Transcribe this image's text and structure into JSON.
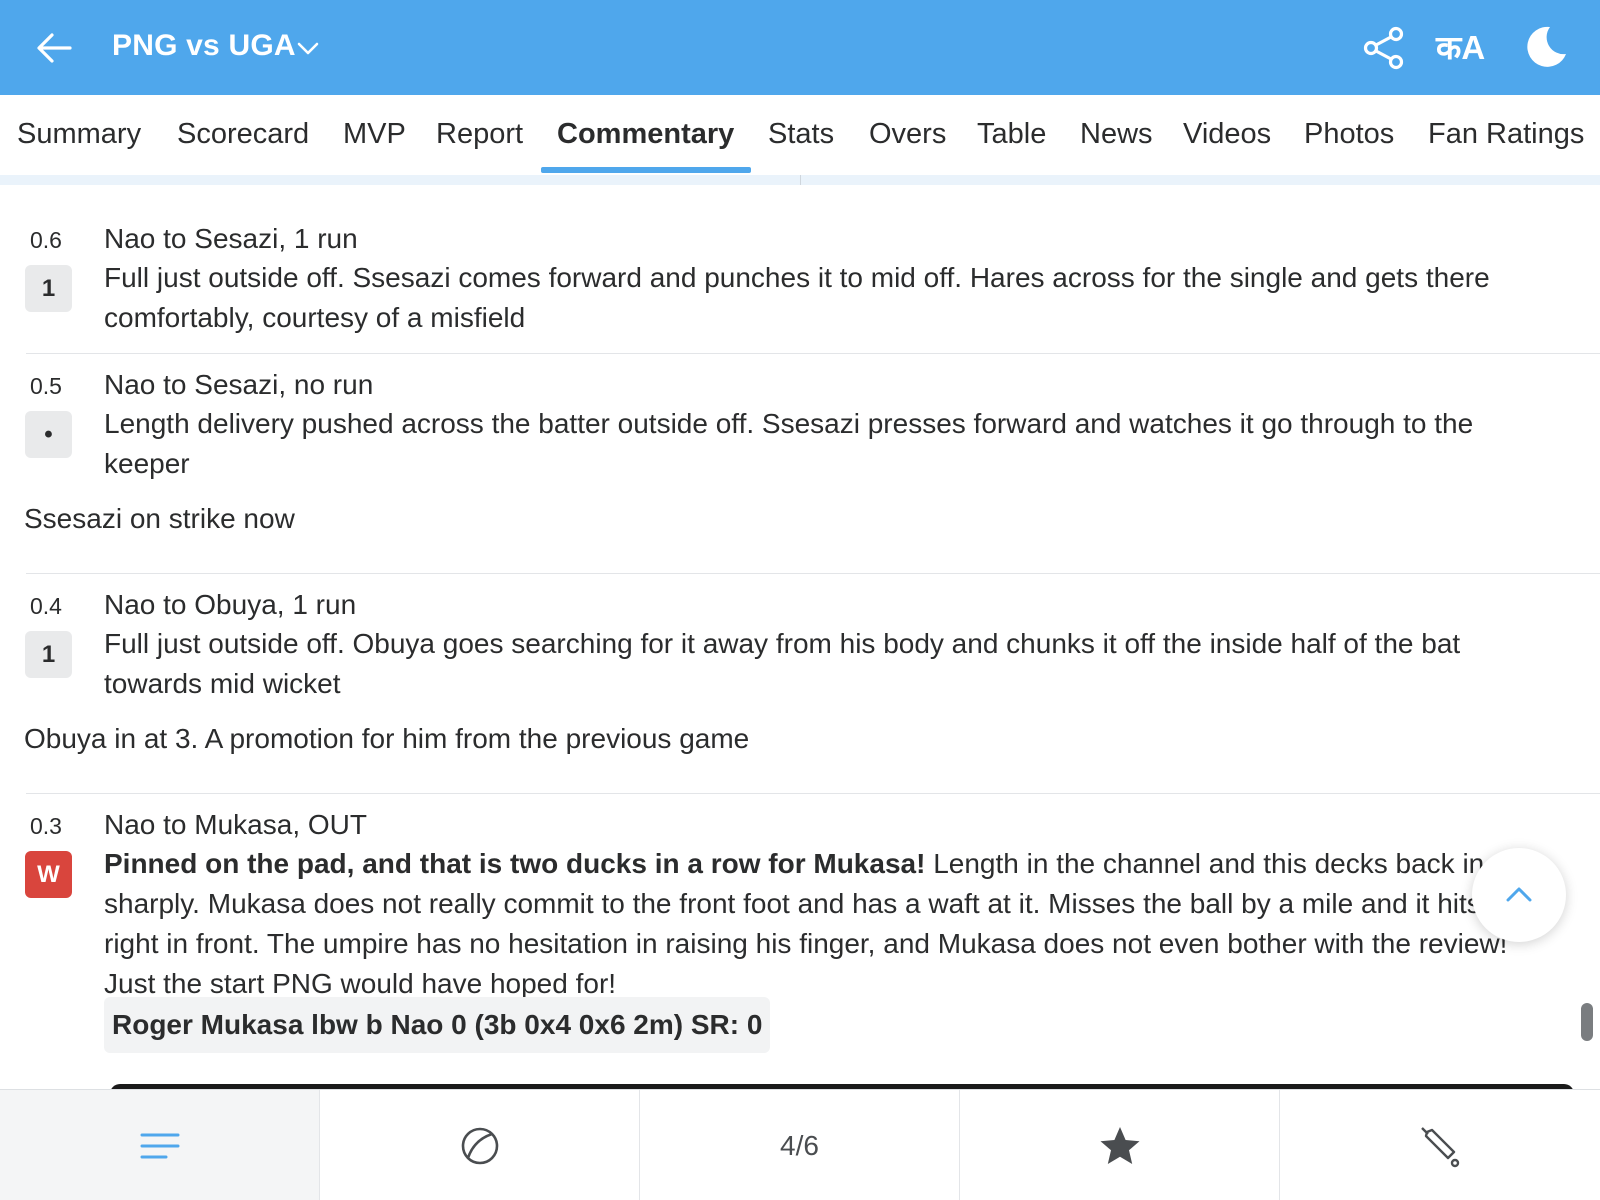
{
  "header": {
    "title": "PNG vs UGA",
    "lang_label": "कA",
    "bg_color": "#4fa7ec"
  },
  "tabs": [
    {
      "label": "Summary"
    },
    {
      "label": "Scorecard"
    },
    {
      "label": "MVP"
    },
    {
      "label": "Report"
    },
    {
      "label": "Commentary",
      "active": true
    },
    {
      "label": "Stats"
    },
    {
      "label": "Overs"
    },
    {
      "label": "Table"
    },
    {
      "label": "News"
    },
    {
      "label": "Videos"
    },
    {
      "label": "Photos"
    },
    {
      "label": "Fan Ratings"
    }
  ],
  "commentary": [
    {
      "over": "0.6",
      "result": "1",
      "headline": "Nao to Sesazi, 1 run",
      "text": "Full just outside off. Ssesazi comes forward and punches it to mid off. Hares across for the single and gets there comfortably, courtesy of a misfield"
    },
    {
      "over": "0.5",
      "result": "•",
      "headline": "Nao to Sesazi, no run",
      "text": "Length delivery pushed across the batter outside off. Ssesazi presses forward and watches it go through to the keeper",
      "note": "Ssesazi on strike now"
    },
    {
      "over": "0.4",
      "result": "1",
      "headline": "Nao to Obuya, 1 run",
      "text": "Full just outside off. Obuya goes searching for it away from his body and chunks it off the inside half of the bat towards mid wicket",
      "note": "Obuya in at 3. A promotion for him from the previous game"
    },
    {
      "over": "0.3",
      "result": "W",
      "headline": "Nao to Mukasa, OUT",
      "text_bold": "Pinned on the pad, and that is two ducks in a row for Mukasa!",
      "text": "Length in the channel and this decks back in sharply. Mukasa does not really commit to the front foot and has a waft at it. Misses the ball by a mile and it hits him right in front. The umpire has no hesitation in raising his finger, and Mukasa does not even bother with the review! Just the start PNG would have hoped for!",
      "dismissal": "Roger Mukasa lbw b Nao 0 (3b 0x4 0x6 2m) SR: 0"
    }
  ],
  "bottom_nav": {
    "items": [
      "menu-icon",
      "ball-icon",
      "page-indicator",
      "star-icon",
      "bat-icon"
    ],
    "page_indicator": "4/6"
  },
  "colors": {
    "accent": "#4fa7ec",
    "wicket": "#d9453d"
  }
}
